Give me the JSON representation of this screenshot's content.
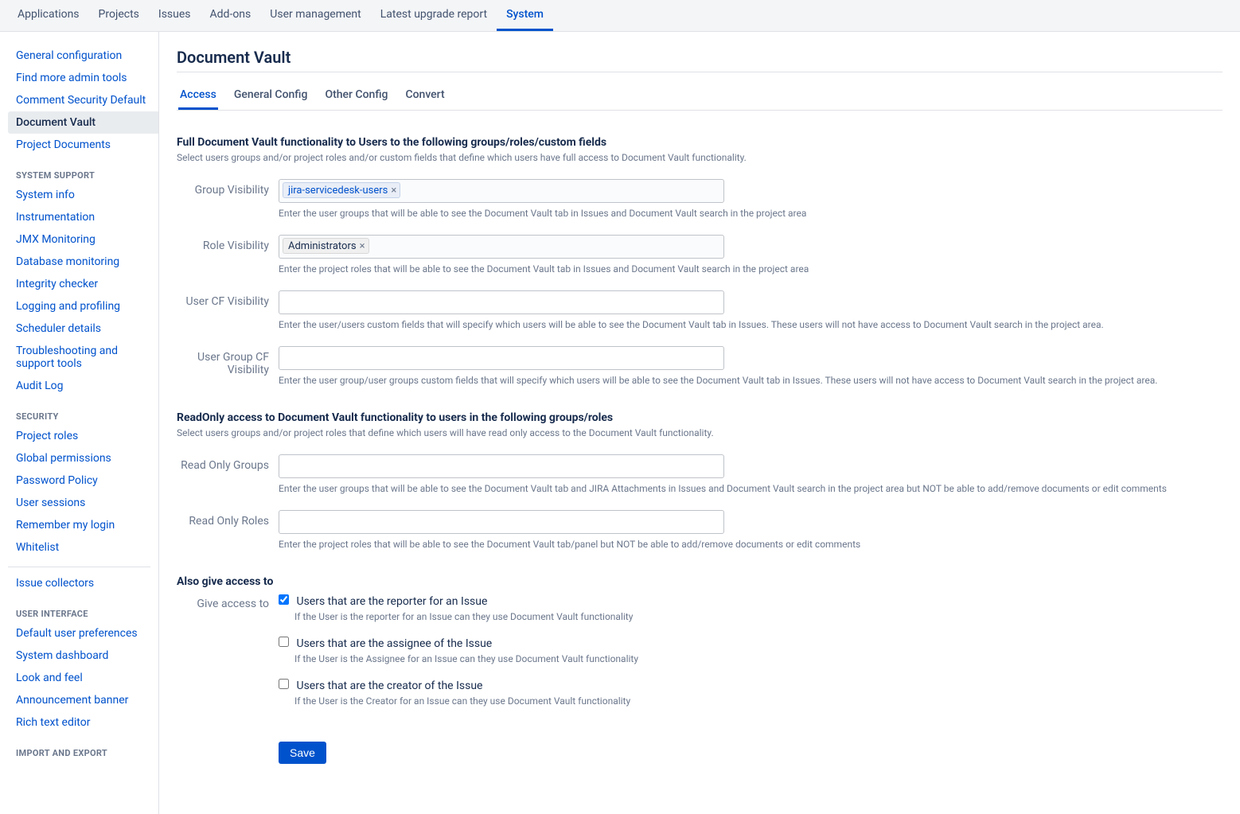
{
  "topnav": {
    "items": [
      {
        "label": "Applications"
      },
      {
        "label": "Projects"
      },
      {
        "label": "Issues"
      },
      {
        "label": "Add-ons"
      },
      {
        "label": "User management"
      },
      {
        "label": "Latest upgrade report"
      },
      {
        "label": "System",
        "active": true
      }
    ]
  },
  "sidebar": {
    "top_items": [
      {
        "label": "General configuration"
      },
      {
        "label": "Find more admin tools"
      },
      {
        "label": "Comment Security Default"
      },
      {
        "label": "Document Vault",
        "active": true
      },
      {
        "label": "Project Documents"
      }
    ],
    "sections": [
      {
        "heading": "SYSTEM SUPPORT",
        "items": [
          "System info",
          "Instrumentation",
          "JMX Monitoring",
          "Database monitoring",
          "Integrity checker",
          "Logging and profiling",
          "Scheduler details",
          "Troubleshooting and support tools",
          "Audit Log"
        ]
      },
      {
        "heading": "SECURITY",
        "items": [
          "Project roles",
          "Global permissions",
          "Password Policy",
          "User sessions",
          "Remember my login",
          "Whitelist"
        ]
      }
    ],
    "after_divider_items": [
      "Issue collectors"
    ],
    "sections2": [
      {
        "heading": "USER INTERFACE",
        "items": [
          "Default user preferences",
          "System dashboard",
          "Look and feel",
          "Announcement banner",
          "Rich text editor"
        ]
      },
      {
        "heading": "IMPORT AND EXPORT",
        "items": []
      }
    ]
  },
  "page": {
    "title": "Document Vault",
    "subtabs": [
      {
        "label": "Access",
        "active": true
      },
      {
        "label": "General Config"
      },
      {
        "label": "Other Config"
      },
      {
        "label": "Convert"
      }
    ]
  },
  "full_access": {
    "title": "Full Document Vault functionality to Users to the following groups/roles/custom fields",
    "desc": "Select users groups and/or project roles and/or custom fields that define which users have full access to Document Vault functionality.",
    "fields": {
      "group_visibility": {
        "label": "Group Visibility",
        "chips": [
          {
            "text": "jira-servicedesk-users",
            "style": "link"
          }
        ],
        "hint": "Enter the user groups that will be able to see the Document Vault tab in Issues and Document Vault search in the project area"
      },
      "role_visibility": {
        "label": "Role Visibility",
        "chips": [
          {
            "text": "Administrators",
            "style": "plain"
          }
        ],
        "hint": "Enter the project roles that will be able to see the Document Vault tab in Issues and Document Vault search in the project area"
      },
      "user_cf_visibility": {
        "label": "User CF Visibility",
        "chips": [],
        "hint": "Enter the user/users custom fields that will specify which users will be able to see the Document Vault tab in Issues. These users will not have access to Document Vault search in the project area."
      },
      "user_group_cf_visibility": {
        "label": "User Group CF Visibility",
        "chips": [],
        "hint": "Enter the user group/user groups custom fields that will specify which users will be able to see the Document Vault tab in Issues. These users will not have access to Document Vault search in the project area."
      }
    }
  },
  "readonly_access": {
    "title": "ReadOnly access to Document Vault functionality to users in the following groups/roles",
    "desc": "Select users groups and/or project roles that define which users will have read only access to the Document Vault functionality.",
    "fields": {
      "read_only_groups": {
        "label": "Read Only Groups",
        "hint": "Enter the user groups that will be able to see the Document Vault tab and JIRA Attachments in Issues and Document Vault search in the project area but NOT be able to add/remove documents or edit comments"
      },
      "read_only_roles": {
        "label": "Read Only Roles",
        "hint": "Enter the project roles that will be able to see the Document Vault tab/panel but NOT be able to add/remove documents or edit comments"
      }
    }
  },
  "also_access": {
    "title": "Also give access to",
    "label": "Give access to",
    "options": [
      {
        "label": "Users that are the reporter for an Issue",
        "hint": "If the User is the reporter for an Issue can they use Document Vault functionality",
        "checked": true
      },
      {
        "label": "Users that are the assignee of the Issue",
        "hint": "If the User is the Assignee for an Issue can they use Document Vault functionality",
        "checked": false
      },
      {
        "label": "Users that are the creator of the Issue",
        "hint": "If the User is the Creator for an Issue can they use Document Vault functionality",
        "checked": false
      }
    ]
  },
  "save_label": "Save"
}
